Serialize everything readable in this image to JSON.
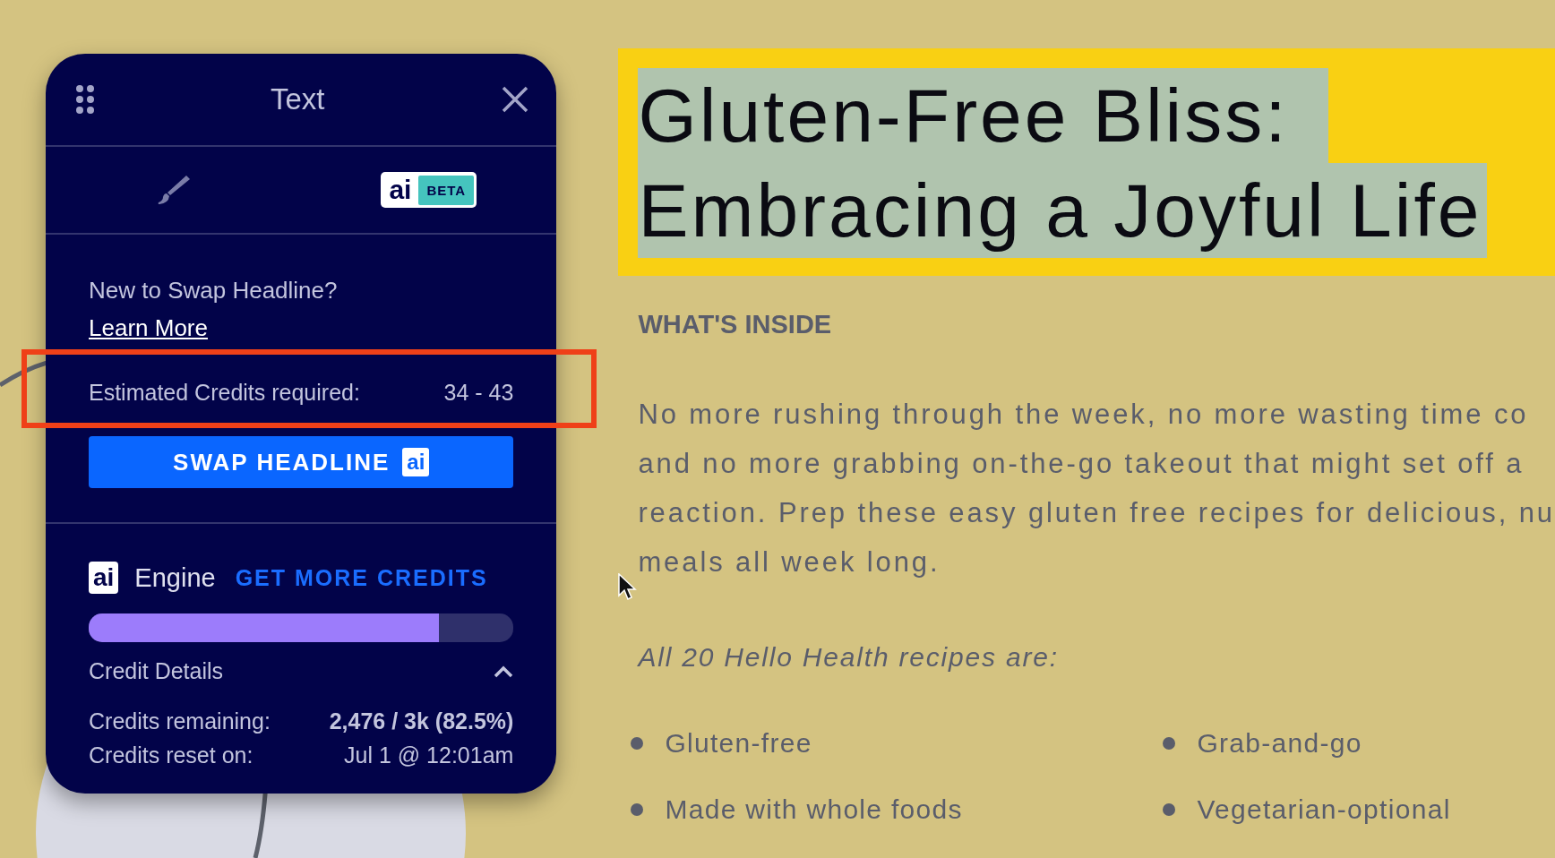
{
  "panel": {
    "title": "Text",
    "tabs": [
      {
        "kind": "brush",
        "selected": false
      },
      {
        "kind": "ai",
        "label": "ai",
        "badge": "BETA",
        "selected": true
      }
    ],
    "intro": "New to Swap Headline?",
    "link": "Learn More",
    "estimate": {
      "label": "Estimated Credits required:",
      "value": "34 - 43"
    },
    "button": {
      "label": "SWAP HEADLINE",
      "badge": "ai"
    },
    "engine": {
      "badge": "ai",
      "label": "Engine",
      "link": "GET MORE CREDITS",
      "level": 0.825
    },
    "details": {
      "title": "Credit Details",
      "expanded": true,
      "rows": [
        {
          "label": "Credits remaining:",
          "value": "2,476 / 3k (82.5%)",
          "bold": true
        },
        {
          "label": "Credits reset on:",
          "value": "Jul 1 @ 12:01am",
          "bold": false
        }
      ]
    }
  },
  "document": {
    "headline": [
      "Gluten-Free Bliss:",
      "Embracing a Joyful Life"
    ],
    "section": "WHAT'S INSIDE",
    "paragraph": [
      "No more rushing through the week, no more wasting time co",
      "and no more grabbing on-the-go takeout that might set off a",
      "reaction. Prep these easy gluten free recipes for delicious, nu",
      "meals all week long."
    ],
    "lead": "All 20 Hello Health recipes are:",
    "bullets": [
      "Gluten-free",
      "Grab-and-go",
      "Made with whole foods",
      "Vegetarian-optional"
    ]
  }
}
